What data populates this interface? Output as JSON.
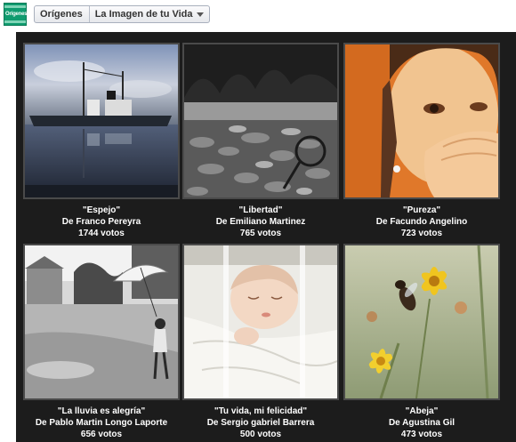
{
  "header": {
    "logo_text": "Orígenes",
    "breadcrumb_origin": "Orígenes",
    "breadcrumb_app": "La Imagen de tu Vida"
  },
  "gallery": [
    {
      "title": "\"Espejo\"",
      "author": "De Franco Pereyra",
      "votes": "1744 votos",
      "subject": "ship-reflection"
    },
    {
      "title": "\"Libertad\"",
      "author": "De Emiliano Martinez",
      "votes": "765 votos",
      "subject": "rocky-shore"
    },
    {
      "title": "\"Pureza\"",
      "author": "De Facundo Angelino",
      "votes": "723 votos",
      "subject": "smiling-child"
    },
    {
      "title": "\"La lluvia es alegría\"",
      "author": "De Pablo Martin Longo Laporte",
      "votes": "656 votos",
      "subject": "girl-umbrella"
    },
    {
      "title": "\"Tu vida, mi felicidad\"",
      "author": "De Sergio gabriel Barrera",
      "votes": "500 votos",
      "subject": "sleeping-baby"
    },
    {
      "title": "\"Abeja\"",
      "author": "De Agustina Gil",
      "votes": "473 votos",
      "subject": "bee-flowers"
    }
  ],
  "colors": {
    "panel_bg": "#1c1c1c",
    "brand_green": "#0f9b6f",
    "caption_text": "#ffffff"
  }
}
